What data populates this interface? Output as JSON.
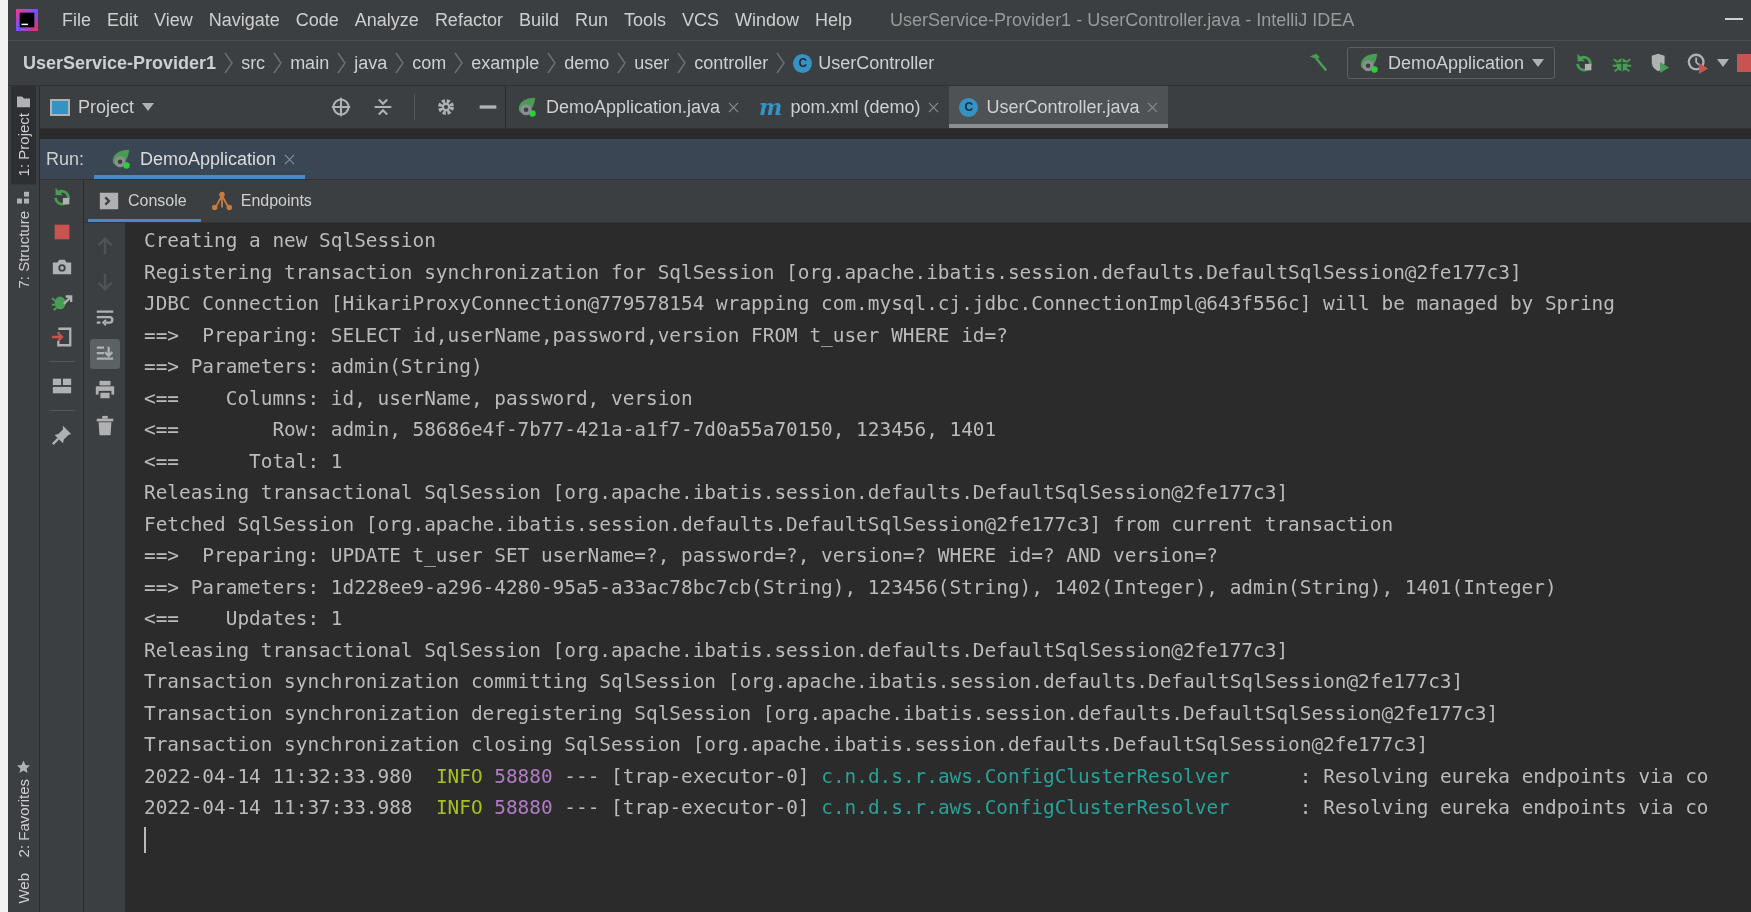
{
  "menu_bar": {
    "items": [
      "File",
      "Edit",
      "View",
      "Navigate",
      "Code",
      "Analyze",
      "Refactor",
      "Build",
      "Run",
      "Tools",
      "VCS",
      "Window",
      "Help"
    ],
    "title": "UserService-Provider1 - UserController.java - IntelliJ IDEA"
  },
  "breadcrumbs": [
    {
      "label": "UserService-Provider1",
      "kind": "project"
    },
    {
      "label": "src",
      "kind": "folder"
    },
    {
      "label": "main",
      "kind": "folder"
    },
    {
      "label": "java",
      "kind": "folder"
    },
    {
      "label": "com",
      "kind": "folder"
    },
    {
      "label": "example",
      "kind": "folder"
    },
    {
      "label": "demo",
      "kind": "folder"
    },
    {
      "label": "user",
      "kind": "folder"
    },
    {
      "label": "controller",
      "kind": "folder"
    },
    {
      "label": "UserController",
      "kind": "class",
      "icon_text": "C"
    }
  ],
  "run_config": {
    "label": "DemoApplication"
  },
  "left_stripe": {
    "top": [
      {
        "label": "1: Project",
        "selected": true
      },
      {
        "label": "7: Structure",
        "selected": false
      }
    ],
    "bottom": [
      {
        "label": "2: Favorites",
        "selected": false
      },
      {
        "label": "Web",
        "selected": false
      }
    ]
  },
  "project_panel": {
    "title": "Project"
  },
  "editor_tabs": [
    {
      "label": "DemoApplication.java",
      "kind": "spring",
      "selected": false
    },
    {
      "label": "pom.xml (demo)",
      "kind": "maven",
      "icon_text": "m",
      "selected": false
    },
    {
      "label": "UserController.java",
      "kind": "class",
      "icon_text": "C",
      "selected": true
    }
  ],
  "run_panel": {
    "label": "Run:",
    "tabs": [
      {
        "label": "DemoApplication",
        "selected": true
      }
    ],
    "subtabs": [
      {
        "label": "Console",
        "selected": true
      },
      {
        "label": "Endpoints",
        "selected": false
      }
    ],
    "console_toolbar": [
      {
        "kind": "up",
        "disabled": true,
        "on": false
      },
      {
        "kind": "down",
        "disabled": true,
        "on": false
      },
      {
        "kind": "wrap",
        "disabled": false,
        "on": false
      },
      {
        "kind": "scroll-end",
        "disabled": false,
        "on": true
      },
      {
        "kind": "print",
        "disabled": false,
        "on": false
      },
      {
        "kind": "trash",
        "disabled": false,
        "on": false
      }
    ],
    "console": [
      {
        "kind": "text",
        "text": "Creating a new SqlSession"
      },
      {
        "kind": "text",
        "text": "Registering transaction synchronization for SqlSession [org.apache.ibatis.session.defaults.DefaultSqlSession@2fe177c3]"
      },
      {
        "kind": "text",
        "text": "JDBC Connection [HikariProxyConnection@779578154 wrapping com.mysql.cj.jdbc.ConnectionImpl@643f556c] will be managed by Spring"
      },
      {
        "kind": "text",
        "text": "==>  Preparing: SELECT id,userName,password,version FROM t_user WHERE id=?"
      },
      {
        "kind": "text",
        "text": "==> Parameters: admin(String)"
      },
      {
        "kind": "text",
        "text": "<==    Columns: id, userName, password, version"
      },
      {
        "kind": "text",
        "text": "<==        Row: admin, 58686e4f-7b77-421a-a1f7-7d0a55a70150, 123456, 1401"
      },
      {
        "kind": "text",
        "text": "<==      Total: 1"
      },
      {
        "kind": "text",
        "text": "Releasing transactional SqlSession [org.apache.ibatis.session.defaults.DefaultSqlSession@2fe177c3]"
      },
      {
        "kind": "text",
        "text": "Fetched SqlSession [org.apache.ibatis.session.defaults.DefaultSqlSession@2fe177c3] from current transaction"
      },
      {
        "kind": "text",
        "text": "==>  Preparing: UPDATE t_user SET userName=?, password=?, version=? WHERE id=? AND version=?"
      },
      {
        "kind": "text",
        "text": "==> Parameters: 1d228ee9-a296-4280-95a5-a33ac78bc7cb(String), 123456(String), 1402(Integer), admin(String), 1401(Integer)"
      },
      {
        "kind": "text",
        "text": "<==    Updates: 1"
      },
      {
        "kind": "text",
        "text": "Releasing transactional SqlSession [org.apache.ibatis.session.defaults.DefaultSqlSession@2fe177c3]"
      },
      {
        "kind": "text",
        "text": "Transaction synchronization committing SqlSession [org.apache.ibatis.session.defaults.DefaultSqlSession@2fe177c3]"
      },
      {
        "kind": "text",
        "text": "Transaction synchronization deregistering SqlSession [org.apache.ibatis.session.defaults.DefaultSqlSession@2fe177c3]"
      },
      {
        "kind": "text",
        "text": "Transaction synchronization closing SqlSession [org.apache.ibatis.session.defaults.DefaultSqlSession@2fe177c3]"
      },
      {
        "kind": "log",
        "time": "2022-04-14 11:32:33.980",
        "level": "INFO",
        "pid": "58880",
        "sep": "---",
        "thread": "[trap-executor-0]",
        "logger": "c.n.d.s.r.aws.ConfigClusterResolver",
        "colon": ":",
        "message": "Resolving eureka endpoints via co"
      },
      {
        "kind": "log",
        "time": "2022-04-14 11:37:33.988",
        "level": "INFO",
        "pid": "58880",
        "sep": "---",
        "thread": "[trap-executor-0]",
        "logger": "c.n.d.s.r.aws.ConfigClusterResolver",
        "colon": ":",
        "message": "Resolving eureka endpoints via co"
      }
    ]
  }
}
